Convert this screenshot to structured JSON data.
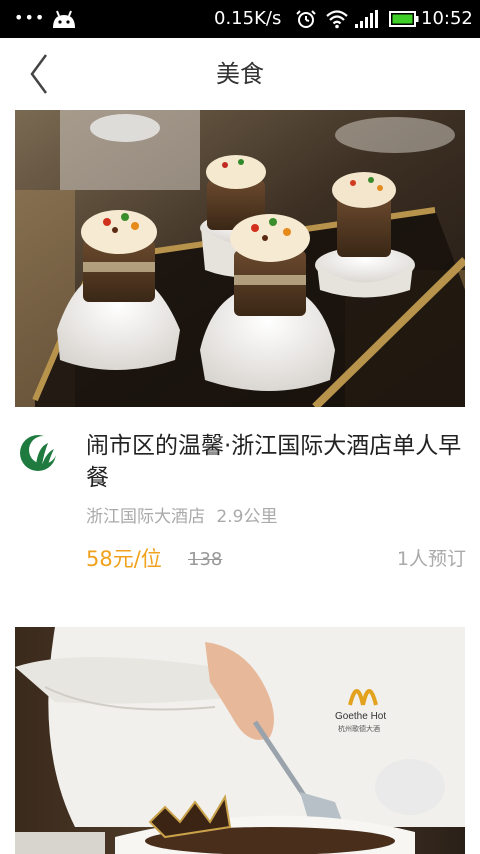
{
  "status_bar": {
    "network_speed": "0.15K/s",
    "time": "10:52",
    "icons": [
      "more-dots-icon",
      "android-icon",
      "alarm-icon",
      "wifi-icon",
      "signal-icon",
      "battery-icon"
    ]
  },
  "nav": {
    "title": "美食",
    "back_icon": "chevron-left-icon"
  },
  "deals": [
    {
      "title": "闹市区的温馨·浙江国际大酒店单人早餐",
      "merchant": "浙江国际大酒店",
      "distance": "2.9公里",
      "price": "58元/位",
      "original_price": "138",
      "booked": "1人预订",
      "logo_icon": "hotel-logo-icon",
      "image": "cupcakes-photo"
    },
    {
      "image": "chef-dessert-photo"
    }
  ],
  "colors": {
    "price": "#f0a21c",
    "status_bar": "#000000",
    "muted_text": "#aaaaaa"
  }
}
